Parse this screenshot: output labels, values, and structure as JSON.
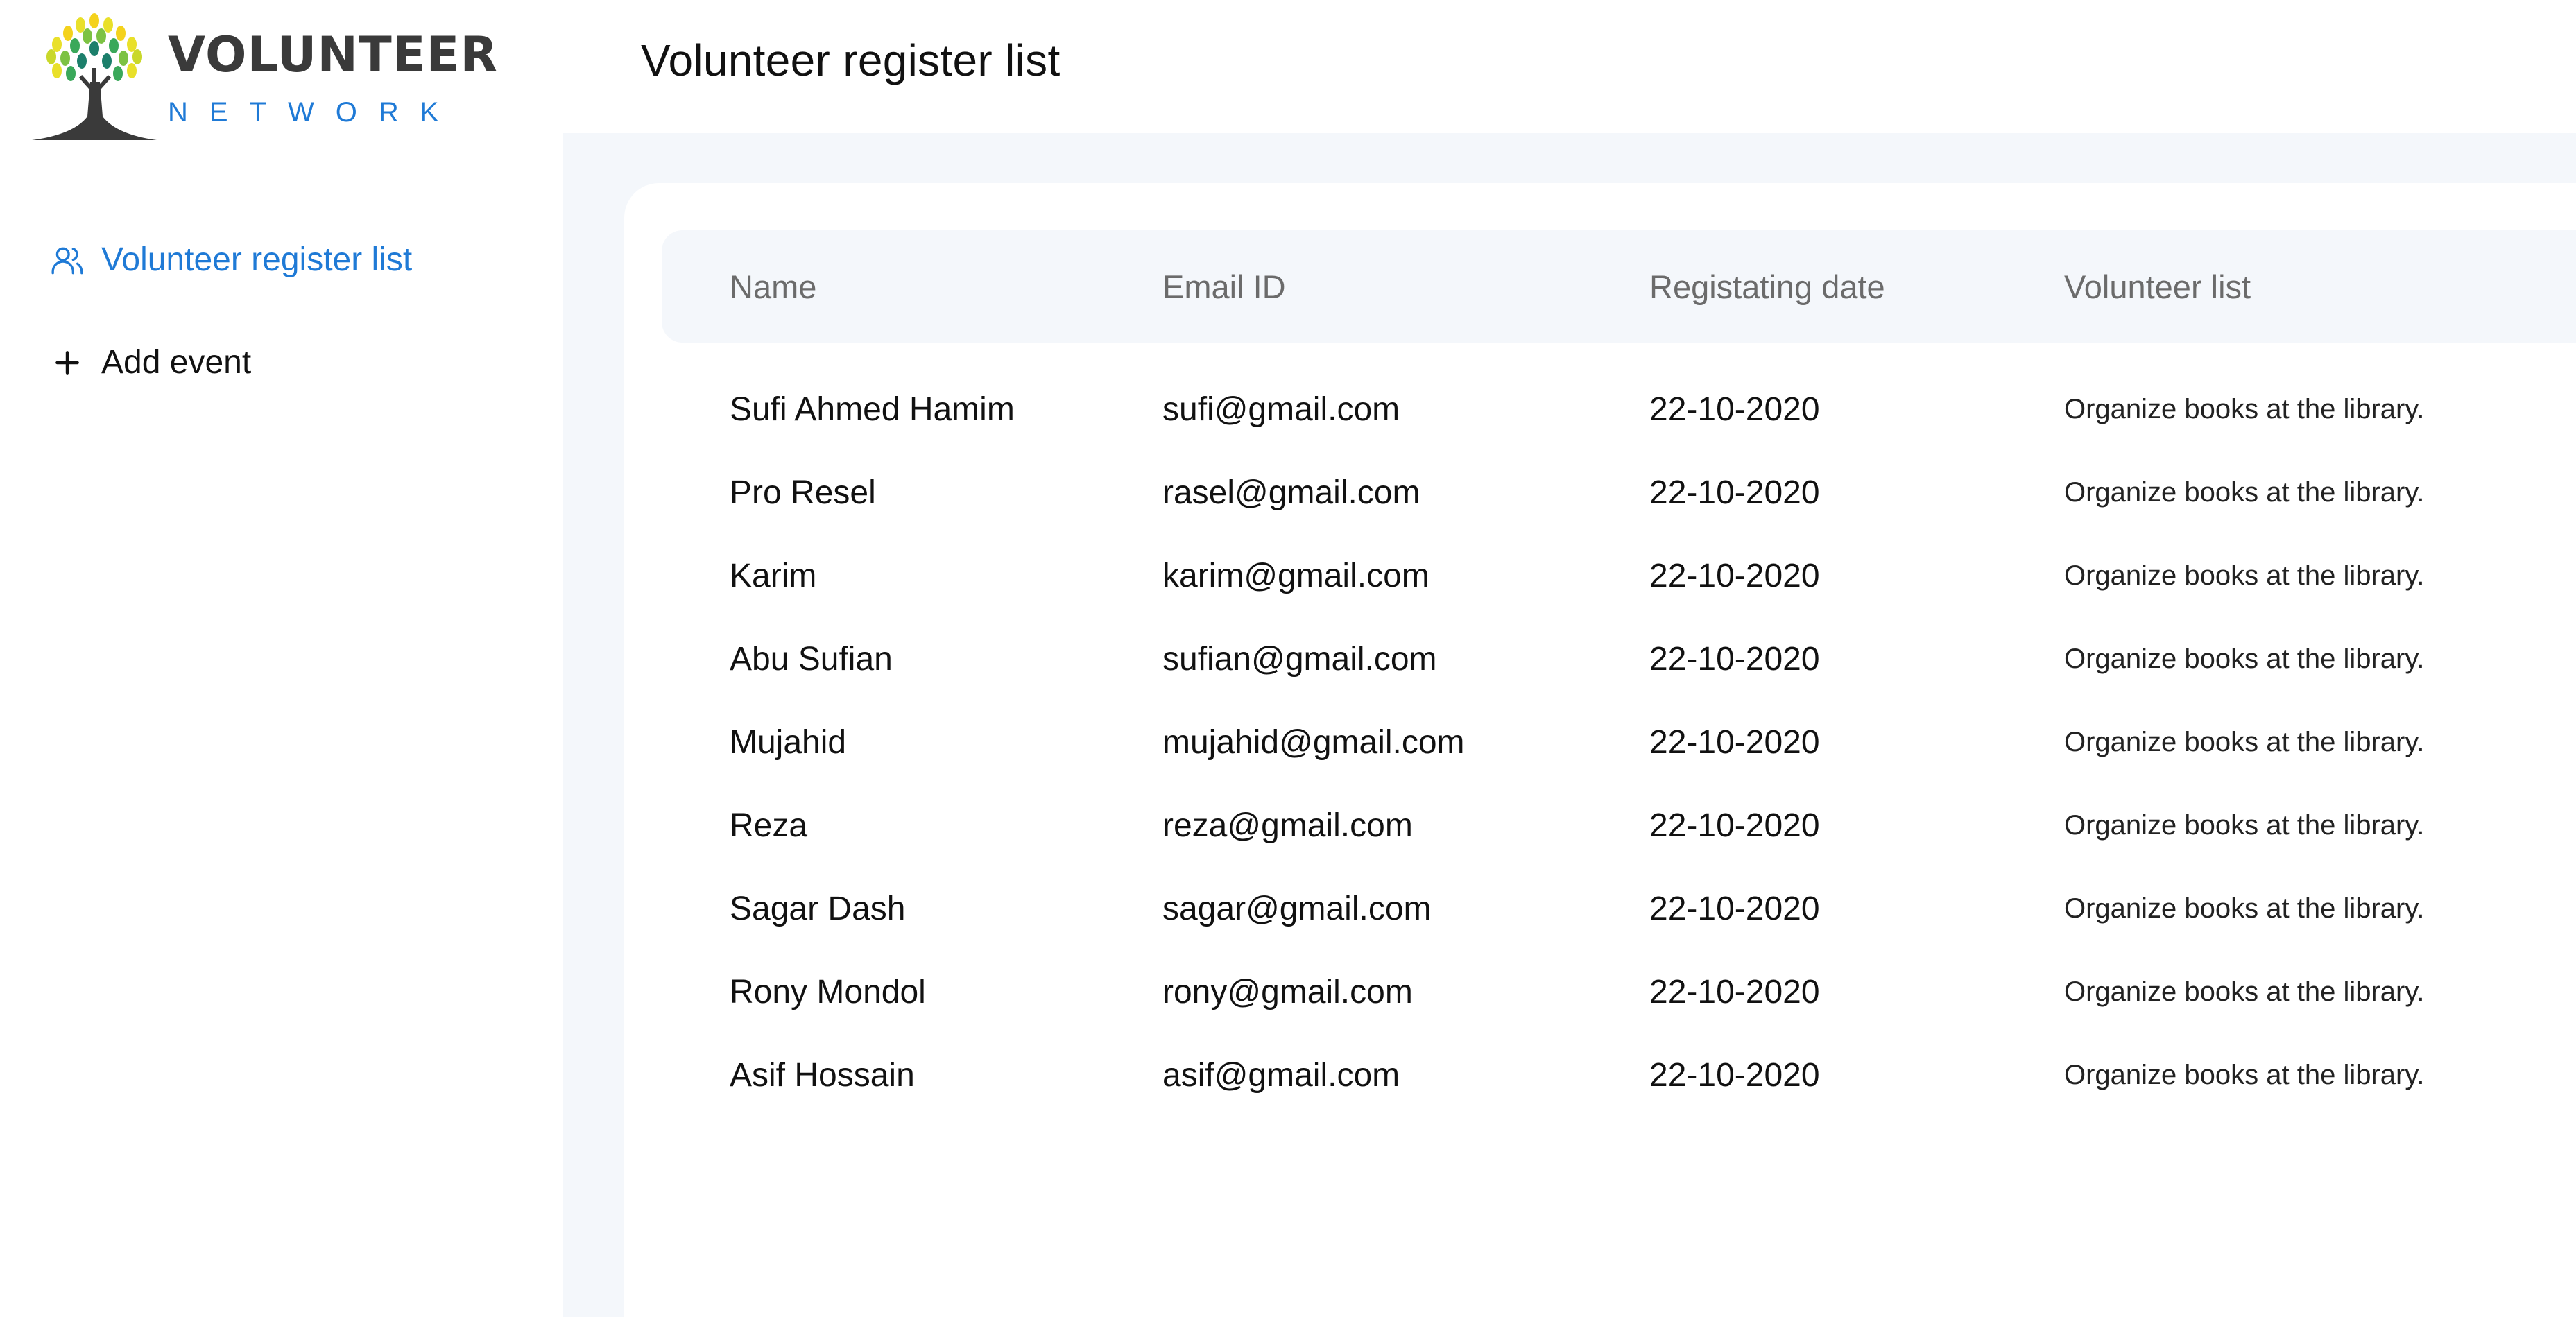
{
  "brand": {
    "name": "VOLUNTEER",
    "tagline": "NETWORK",
    "accent_color": "#1f7ad6",
    "text_color": "#3a3a3a"
  },
  "sidebar": {
    "items": [
      {
        "label": "Volunteer register list",
        "icon": "users-icon",
        "active": true
      },
      {
        "label": "Add event",
        "icon": "plus-icon",
        "active": false
      }
    ]
  },
  "header": {
    "title": "Volunteer register list"
  },
  "table": {
    "columns": [
      "Name",
      "Email ID",
      "Registating date",
      "Volunteer list"
    ],
    "rows": [
      [
        "Sufi Ahmed Hamim",
        "sufi@gmail.com",
        "22-10-2020",
        "Organize books at the library."
      ],
      [
        "Pro Resel",
        "rasel@gmail.com",
        "22-10-2020",
        "Organize books at the library."
      ],
      [
        "Karim",
        "karim@gmail.com",
        "22-10-2020",
        "Organize books at the library."
      ],
      [
        "Abu Sufian",
        "sufian@gmail.com",
        "22-10-2020",
        "Organize books at the library."
      ],
      [
        "Mujahid",
        "mujahid@gmail.com",
        "22-10-2020",
        "Organize books at the library."
      ],
      [
        "Reza",
        "reza@gmail.com",
        "22-10-2020",
        "Organize books at the library."
      ],
      [
        "Sagar Dash",
        "sagar@gmail.com",
        "22-10-2020",
        "Organize books at the library."
      ],
      [
        "Rony Mondol",
        "rony@gmail.com",
        "22-10-2020",
        "Organize books at the library."
      ],
      [
        "Asif Hossain",
        "asif@gmail.com",
        "22-10-2020",
        "Organize books at the library."
      ]
    ]
  }
}
